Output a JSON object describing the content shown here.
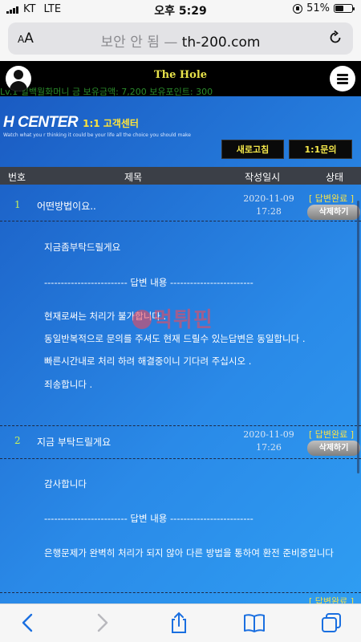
{
  "status": {
    "carrier": "KT",
    "network": "LTE",
    "time": "오후 5:29",
    "battery": "51%",
    "battery_level": 0.51
  },
  "browser": {
    "aa_label": "AA",
    "security_text": "보안 안 됨",
    "dash": "—",
    "domain": "th-200.com"
  },
  "site": {
    "title": "The Hole",
    "marquee": "Lv.1 일백월화머니 금   보유금액: 7,200   보유포인트: 300",
    "logo_text": "H CENTER",
    "logo_korean": "1:1 고객센터",
    "logo_subtitle": "Watch what you r thinking it could be your life all the choice you should make",
    "refresh_button": "새로고침",
    "inquiry_button": "1:1문의"
  },
  "table": {
    "headers": {
      "num": "번호",
      "subject": "제목",
      "date": "작성일시",
      "status": "상태"
    },
    "rows": [
      {
        "num": "1",
        "subject": "어떤방법이요..",
        "date": "2020-11-09",
        "time": "17:28",
        "status": "[ 답변완료 ]",
        "delete": "삭제하기",
        "question": "지금좀부탁드릴게요",
        "divider": "------------------------- 답변 내용 -------------------------",
        "answer": [
          "현재로써는 처리가 불가합니다 .",
          "동일반복적으로 문의를 주셔도 현재 드릴수 있는답변은 동일합니다 .",
          "빠른시간내로 처리 하려 해결중이니 기다려 주십시오 .",
          "죄송합니다 ."
        ]
      },
      {
        "num": "2",
        "subject": "지금 부탁드릴게요",
        "date": "2020-11-09",
        "time": "17:26",
        "status": "[ 답변완료 ]",
        "delete": "삭제하기",
        "question": "감사합니다",
        "divider": "------------------------- 답변 내용 -------------------------",
        "answer": [
          "은행문제가 완벽히 처리가 되지 않아 다른 방법을 통하여 환전 준비중입니다"
        ]
      }
    ],
    "next_status": "[ 답변완료 ]"
  },
  "watermark": "먹튀핀",
  "colors": {
    "accent_yellow": "#f7e24a",
    "number_green": "#c8f05a",
    "bg_blue": "#1e6fd0"
  }
}
